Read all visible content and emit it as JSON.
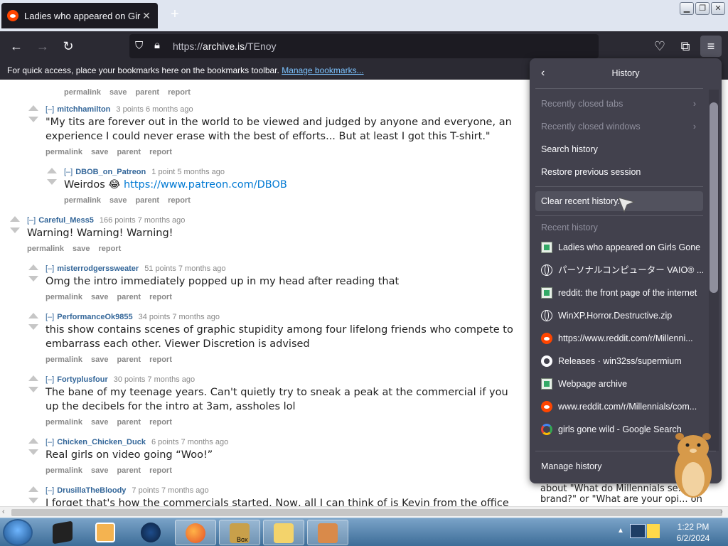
{
  "browser": {
    "tab_title": "Ladies who appeared on Girls Gone Wild",
    "url_scheme": "https://",
    "url_host": "archive.is",
    "url_path": "/TEnoy",
    "bookmarks_notice": "For quick access, place your bookmarks here on the bookmarks toolbar.",
    "bookmarks_link": "Manage bookmarks..."
  },
  "thread": {
    "top_links": [
      "permalink",
      "save",
      "parent",
      "report"
    ],
    "comments": [
      {
        "user": "mitchhamilton",
        "meta": "3 points 6 months ago",
        "body": "\"My tits are forever out in the world to be viewed and judged by anyone and everyone, an experience I could never erase with the best of efforts... But at least I got this T-shirt.\"",
        "links": [
          "permalink",
          "save",
          "parent",
          "report"
        ]
      },
      {
        "user": "DBOB_on_Patreon",
        "meta": "1 point 5 months ago",
        "body_prefix": "Weirdos 😂 ",
        "body_link": "https://www.patreon.com/DBOB",
        "links": [
          "permalink",
          "save",
          "parent",
          "report"
        ]
      },
      {
        "user": "Careful_Mess5",
        "meta": "166 points 7 months ago",
        "body": "Warning! Warning! Warning!",
        "links": [
          "permalink",
          "save",
          "report"
        ]
      },
      {
        "user": "misterrodgerssweater",
        "meta": "51 points 7 months ago",
        "body": "Omg the intro immediately popped up in my head after reading that",
        "links": [
          "permalink",
          "save",
          "parent",
          "report"
        ]
      },
      {
        "user": "PerformanceOk9855",
        "meta": "34 points 7 months ago",
        "body": "this show contains scenes of graphic stupidity among four lifelong friends who compete to embarrass each other. Viewer Discretion is advised",
        "links": [
          "permalink",
          "save",
          "parent",
          "report"
        ]
      },
      {
        "user": "Fortyplusfour",
        "meta": "30 points 7 months ago",
        "body": "The bane of my teenage years. Can't quietly try to sneak a peak at the commercial if you up the decibels for the intro at 3am, assholes lol",
        "links": [
          "permalink",
          "save",
          "parent",
          "report"
        ]
      },
      {
        "user": "Chicken_Chicken_Duck",
        "meta": "6 points 7 months ago",
        "body": "Real girls on video going “Woo!”",
        "links": [
          "permalink",
          "save",
          "parent",
          "report"
        ]
      },
      {
        "user": "DrusillaTheBloody",
        "meta": "7 points 7 months ago",
        "body": "I forget that's how the commercials started. Now, all I can think of is Kevin from the office",
        "links": []
      }
    ],
    "toggle": "[–]",
    "behind_panel_text": "about \"What do Millennials se... brand?\" or \"What are your opi... on"
  },
  "history_panel": {
    "title": "History",
    "menu": [
      {
        "label": "Recently closed tabs",
        "enabled": false,
        "submenu": true
      },
      {
        "label": "Recently closed windows",
        "enabled": false,
        "submenu": true
      },
      {
        "label": "Search history",
        "enabled": true,
        "submenu": false
      },
      {
        "label": "Restore previous session",
        "enabled": true,
        "submenu": false
      },
      {
        "label": "Clear recent history...",
        "enabled": true,
        "submenu": false
      }
    ],
    "recent_header": "Recent history",
    "recent": [
      {
        "label": "Ladies who appeared on Girls Gone ...",
        "icon": "archive-icon"
      },
      {
        "label": "パーソナルコンピューター VAIO® ...",
        "icon": "globe-icon"
      },
      {
        "label": "reddit: the front page of the internet",
        "icon": "archive-icon"
      },
      {
        "label": "WinXP.Horror.Destructive.zip",
        "icon": "globe-icon"
      },
      {
        "label": "https://www.reddit.com/r/Millenni...",
        "icon": "reddit-icon"
      },
      {
        "label": "Releases · win32ss/supermium",
        "icon": "github-icon"
      },
      {
        "label": "Webpage archive",
        "icon": "archive-icon"
      },
      {
        "label": "www.reddit.com/r/Millennials/com...",
        "icon": "reddit-icon"
      },
      {
        "label": "girls gone wild - Google Search",
        "icon": "google-icon"
      }
    ],
    "manage": "Manage history"
  },
  "taskbar": {
    "time": "1:22 PM",
    "date": "6/2/2024",
    "pinned": [
      "media-player-icon",
      "folder-icon",
      "globe-app-icon",
      "firefox-icon",
      "box-game-icon",
      "mail-folder-icon",
      "house-icon"
    ],
    "box_label": "Box"
  }
}
